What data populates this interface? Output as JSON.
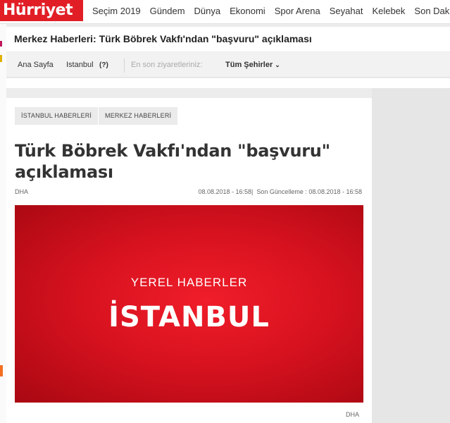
{
  "logo": {
    "text": "Hürriyet"
  },
  "nav": {
    "items": [
      {
        "label": "Seçim 2019"
      },
      {
        "label": "Gündem"
      },
      {
        "label": "Dünya"
      },
      {
        "label": "Ekonomi"
      },
      {
        "label": "Spor Arena"
      },
      {
        "label": "Seyahat"
      },
      {
        "label": "Kelebek"
      },
      {
        "label": "Son Dakika"
      }
    ]
  },
  "section": {
    "title": "Merkez Haberleri: Türk Böbrek Vakfı'ndan \"başvuru\" açıklaması"
  },
  "breadcrumb": {
    "home": "Ana Sayfa",
    "city": "Istanbul",
    "city_help": "(?)",
    "recent_label": "En son ziyaretleriniz:",
    "all_cities": "Tüm Şehirler"
  },
  "article": {
    "tags": [
      {
        "label": "İSTANBUL HABERLERİ"
      },
      {
        "label": "MERKEZ HABERLERİ"
      }
    ],
    "headline": "Türk Böbrek Vakfı'ndan \"başvuru\" açıklaması",
    "source": "DHA",
    "published": "08.08.2018 - 16:58",
    "updated_label": "Son Güncelleme :",
    "updated": "08.08.2018 - 16:58",
    "image": {
      "subtitle": "YEREL HABERLER",
      "title": "İSTANBUL"
    },
    "image_caption": "DHA"
  },
  "colors": {
    "brand": "#e11e26",
    "hero": "#d8121f"
  }
}
